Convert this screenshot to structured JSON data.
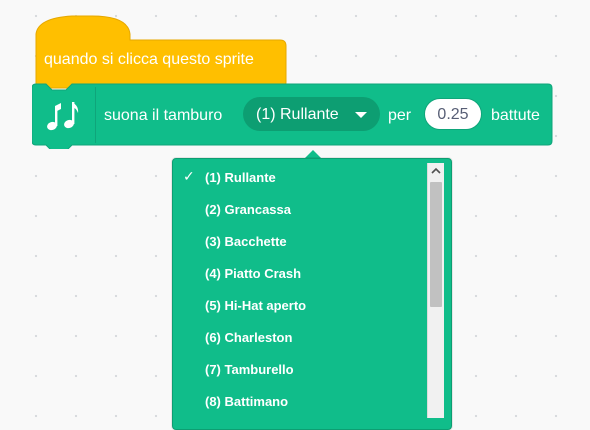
{
  "hat_block": {
    "label": "quando si clicca questo sprite"
  },
  "sound_block": {
    "icon": "music-notes-icon",
    "text_before": "suona il tamburo",
    "drum_selected": "(1) Rullante",
    "text_per": "per",
    "beats_value": "0.25",
    "text_after": "battute"
  },
  "drum_menu": {
    "checkmark": "✓",
    "selected_index": 0,
    "items": [
      "(1) Rullante",
      "(2) Grancassa",
      "(3) Bacchette",
      "(4) Piatto Crash",
      "(5) Hi-Hat aperto",
      "(6) Charleston",
      "(7) Tamburello",
      "(8) Battimano"
    ]
  },
  "colors": {
    "events": "#ffbf00",
    "sound": "#10bd8a",
    "sound_dark": "#0d9e72"
  }
}
